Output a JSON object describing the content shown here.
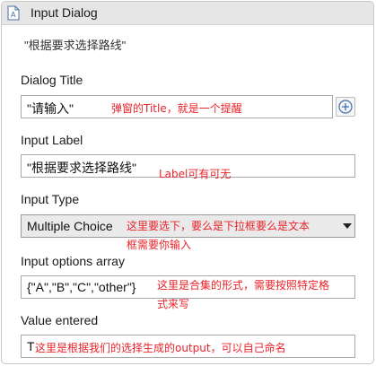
{
  "header": {
    "title": "Input Dialog",
    "icon": "dialog-icon"
  },
  "subtitle": "\"根据要求选择路线\"",
  "dialog_title": {
    "label": "Dialog Title",
    "value": "\"请输入\"",
    "annotation": "弹窗的Title，就是一个提醒",
    "button_icon": "plus-circle-icon"
  },
  "input_label": {
    "label": "Input Label",
    "value": "\"根据要求选择路线\"",
    "annotation": "Label可有可无"
  },
  "input_type": {
    "label": "Input Type",
    "selected": "Multiple Choice",
    "annotation_line1": "这里要选下，要么是下拉框要么是文本",
    "annotation_line2": "框需要你输入"
  },
  "options_array": {
    "label": "Input options array",
    "value": "{\"A\",\"B\",\"C\",\"other\"}",
    "annotation_line1": "这里是合集的形式，需要按照特定格",
    "annotation_line2": "式来写"
  },
  "value_entered": {
    "label": "Value entered",
    "value": "T",
    "annotation": "这里是根据我们的选择生成的output，可以自己命名"
  },
  "colors": {
    "annotation": "#e8232a",
    "header_bg": "#e6e6e6"
  }
}
